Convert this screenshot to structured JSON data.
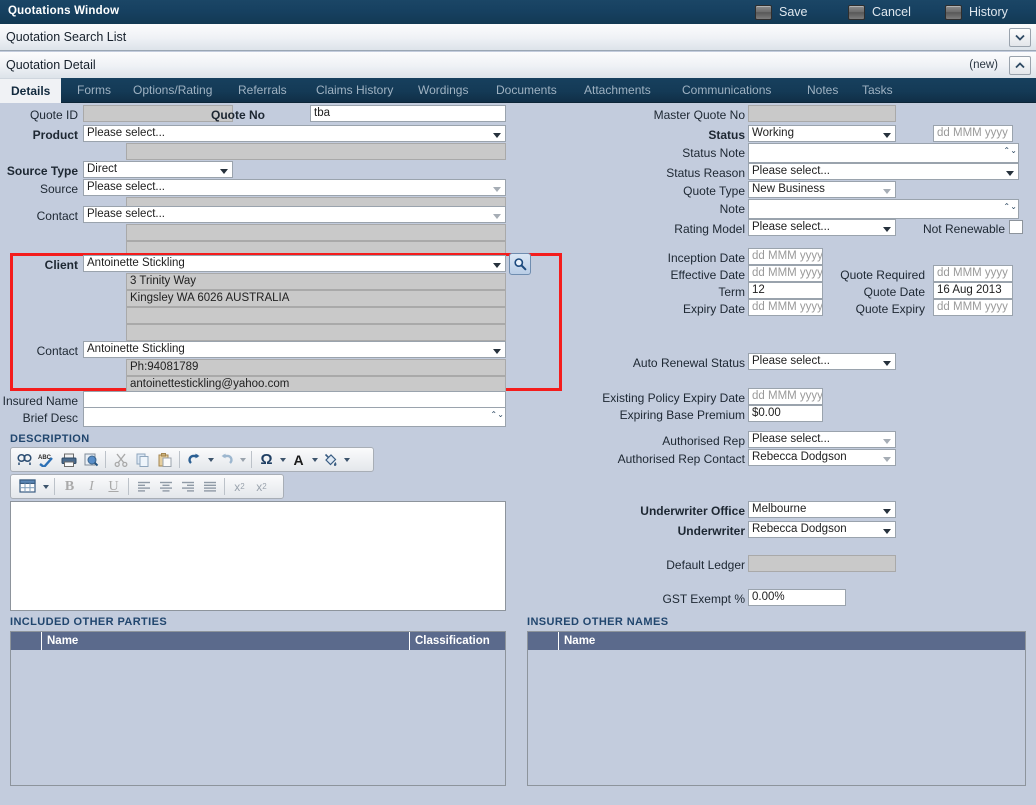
{
  "window": {
    "title": "Quotations Window",
    "actions": [
      {
        "label": "Save",
        "icon": "save-icon"
      },
      {
        "label": "Cancel",
        "icon": "cancel-icon"
      },
      {
        "label": "History",
        "icon": "history-icon"
      }
    ]
  },
  "bars": {
    "search_list": "Quotation Search List",
    "detail": "Quotation Detail",
    "detail_tag": "(new)",
    "expand_icon": "chevron-down-icon",
    "collapse_icon": "chevron-up-icon"
  },
  "tabs": [
    {
      "label": "Details",
      "active": true
    },
    {
      "label": "Forms",
      "active": false
    },
    {
      "label": "Options/Rating",
      "active": false
    },
    {
      "label": "Referrals",
      "active": false
    },
    {
      "label": "Claims History",
      "active": false
    },
    {
      "label": "Wordings",
      "active": false
    },
    {
      "label": "Documents",
      "active": false
    },
    {
      "label": "Attachments",
      "active": false
    },
    {
      "label": "Communications",
      "active": false
    },
    {
      "label": "Notes",
      "active": false
    },
    {
      "label": "Tasks",
      "active": false
    }
  ],
  "left": {
    "quote_id_label": "Quote ID",
    "quote_id_value": "",
    "quote_no_label": "Quote No",
    "quote_no_value": "tba",
    "product_label": "Product",
    "product_value": "Please select...",
    "product_sub_value": "",
    "source_type_label": "Source Type",
    "source_type_value": "Direct",
    "source_label": "Source",
    "source_value": "Please select...",
    "source_sub_value": "",
    "contact_top_label": "Contact",
    "contact_top_value": "Please select...",
    "contact_sub1": "",
    "contact_sub2": "",
    "client_label": "Client",
    "client_value": "Antoinette Stickling",
    "client_addr1": "3 Trinity Way",
    "client_addr2": "Kingsley WA 6026 AUSTRALIA",
    "client_addr3": "",
    "client_addr4": "",
    "client_search_icon": "search-icon",
    "contact_label": "Contact",
    "contact_value": "Antoinette Stickling",
    "contact_phone": "Ph:94081789",
    "contact_email": "antoinettestickling@yahoo.com",
    "insured_name_label": "Insured Name",
    "insured_name_value": "",
    "brief_desc_label": "Brief Desc",
    "brief_desc_value": "",
    "description_heading": "DESCRIPTION",
    "editor_body_value": ""
  },
  "editor_toolbar": {
    "row1": [
      {
        "name": "find-icon",
        "glyph": "ÁA",
        "kind": "find"
      },
      {
        "name": "spellcheck-icon",
        "glyph": "ABC",
        "kind": "spell"
      },
      {
        "name": "print-icon",
        "glyph": "print",
        "kind": "print"
      },
      {
        "name": "print-preview-icon",
        "glyph": "preview",
        "kind": "preview"
      },
      {
        "name": "cut-icon",
        "glyph": "✂",
        "kind": "cut"
      },
      {
        "name": "copy-icon",
        "glyph": "copy",
        "kind": "copy"
      },
      {
        "name": "paste-icon",
        "glyph": "paste",
        "kind": "paste"
      },
      {
        "name": "undo-icon",
        "glyph": "↶",
        "kind": "undo"
      },
      {
        "name": "redo-icon",
        "glyph": "↷",
        "kind": "redo"
      },
      {
        "name": "symbol-icon",
        "glyph": "Ω",
        "kind": "symbol"
      },
      {
        "name": "font-color-icon",
        "glyph": "A",
        "kind": "fontcolor"
      },
      {
        "name": "highlight-color-icon",
        "glyph": "fill",
        "kind": "fill"
      }
    ],
    "row2": [
      {
        "name": "table-icon",
        "glyph": "table",
        "kind": "table"
      },
      {
        "name": "bold-icon",
        "glyph": "B",
        "kind": "bold"
      },
      {
        "name": "italic-icon",
        "glyph": "I",
        "kind": "italic"
      },
      {
        "name": "underline-icon",
        "glyph": "U",
        "kind": "underline"
      },
      {
        "name": "align-left-icon",
        "glyph": "lines",
        "kind": "alignleft"
      },
      {
        "name": "align-center-icon",
        "glyph": "lines",
        "kind": "aligncenter"
      },
      {
        "name": "align-right-icon",
        "glyph": "lines",
        "kind": "alignright"
      },
      {
        "name": "align-justify-icon",
        "glyph": "lines",
        "kind": "alignjustify"
      },
      {
        "name": "superscript-icon",
        "glyph": "x²",
        "kind": "sup"
      },
      {
        "name": "subscript-icon",
        "glyph": "x₂",
        "kind": "sub"
      }
    ]
  },
  "right": {
    "master_quote_no_label": "Master Quote No",
    "master_quote_no_value": "",
    "status_label": "Status",
    "status_value": "Working",
    "status_date_placeholder": "dd MMM yyyy",
    "status_date_value": "",
    "status_note_label": "Status Note",
    "status_note_value": "",
    "status_reason_label": "Status Reason",
    "status_reason_value": "Please select...",
    "quote_type_label": "Quote Type",
    "quote_type_value": "New Business",
    "note_label": "Note",
    "note_value": "",
    "rating_model_label": "Rating Model",
    "rating_model_value": "Please select...",
    "not_renewable_label": "Not Renewable",
    "not_renewable_checked": false,
    "inception_date_label": "Inception Date",
    "inception_date_value": "",
    "effective_date_label": "Effective Date",
    "effective_date_value": "",
    "term_label": "Term",
    "term_value": "12",
    "expiry_date_label": "Expiry Date",
    "expiry_date_value": "",
    "quote_required_label": "Quote Required",
    "quote_required_value": "",
    "quote_date_label": "Quote Date",
    "quote_date_value": "16 Aug 2013",
    "quote_expiry_label": "Quote Expiry",
    "quote_expiry_value": "",
    "date_placeholder": "dd MMM yyyy",
    "auto_renewal_status_label": "Auto Renewal Status",
    "auto_renewal_status_value": "Please select...",
    "existing_policy_expiry_label": "Existing Policy Expiry Date",
    "existing_policy_expiry_value": "",
    "expiring_base_premium_label": "Expiring Base Premium",
    "expiring_base_premium_value": "$0.00",
    "authorised_rep_label": "Authorised Rep",
    "authorised_rep_value": "Please select...",
    "authorised_rep_contact_label": "Authorised Rep Contact",
    "authorised_rep_contact_value": "Rebecca Dodgson",
    "underwriter_office_label": "Underwriter Office",
    "underwriter_office_value": "Melbourne",
    "underwriter_label": "Underwriter",
    "underwriter_value": "Rebecca Dodgson",
    "default_ledger_label": "Default Ledger",
    "default_ledger_value": "",
    "gst_exempt_label": "GST Exempt %",
    "gst_exempt_value": "0.00%"
  },
  "grids": {
    "included_other_parties": {
      "heading": "INCLUDED OTHER PARTIES",
      "columns": [
        "",
        "Name",
        "Classification"
      ],
      "rows": []
    },
    "insured_other_names": {
      "heading": "INSURED OTHER NAMES",
      "columns": [
        "",
        "Name"
      ],
      "rows": []
    }
  },
  "colors": {
    "titlebar": "#164060",
    "tabstrip": "#143a56",
    "surface": "#c3ccdd",
    "grid_header": "#5b6a8c",
    "highlight": "#f41c1c",
    "section_heading": "#21466e"
  }
}
